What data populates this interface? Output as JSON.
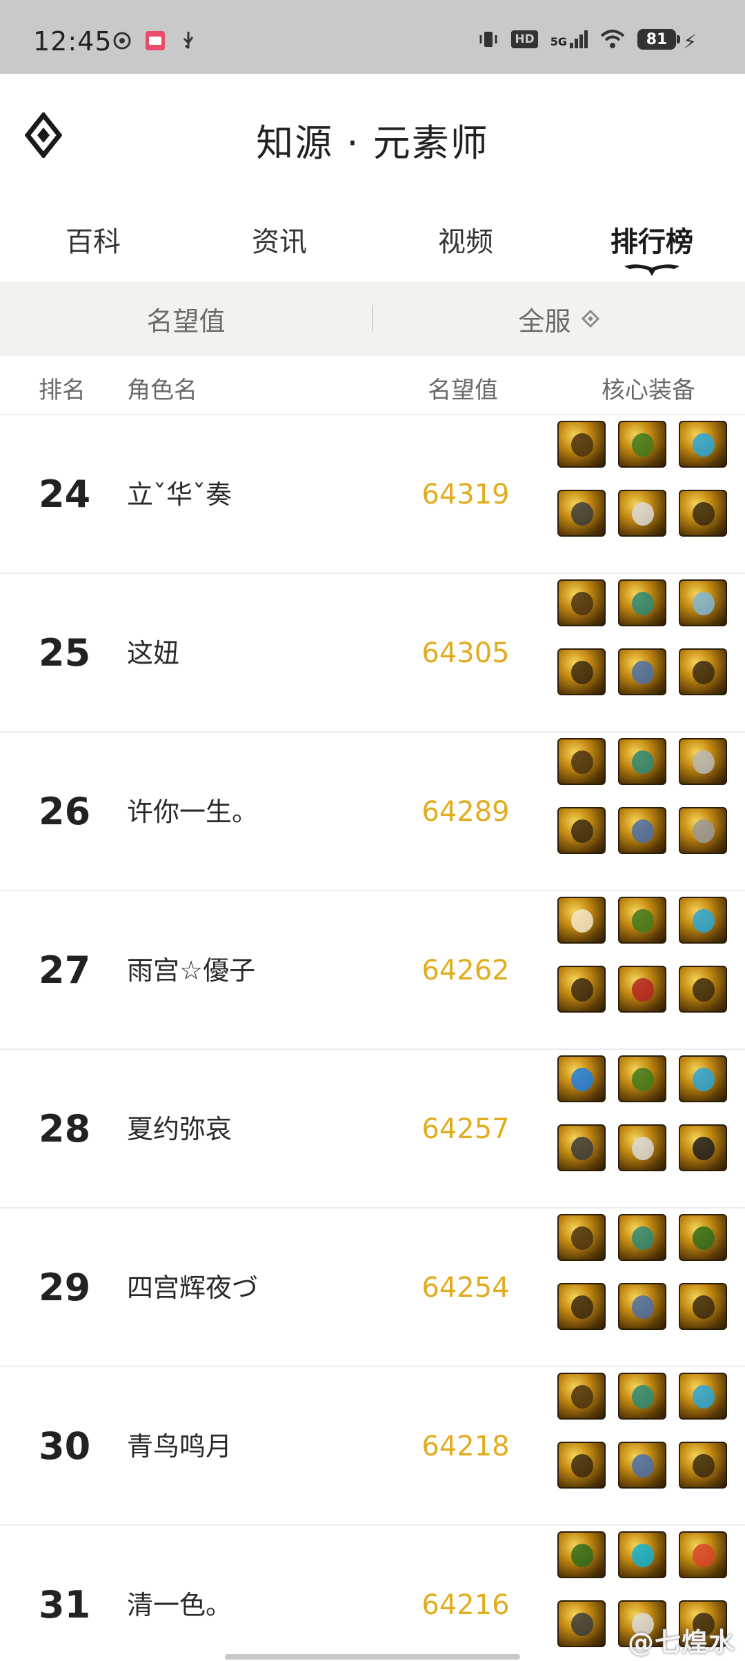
{
  "status_bar": {
    "time": "12:45",
    "hd": "HD",
    "net": "5G",
    "battery": "81"
  },
  "header": {
    "title": "知源 · 元素师"
  },
  "tabs": [
    {
      "label": "百科"
    },
    {
      "label": "资讯"
    },
    {
      "label": "视频"
    },
    {
      "label": "排行榜"
    }
  ],
  "filters": {
    "left": "名望值",
    "right": "全服"
  },
  "columns": {
    "rank": "排名",
    "name": "角色名",
    "score": "名望值",
    "equip": "核心装备"
  },
  "rows": [
    {
      "rank": "24",
      "name": "立ˇ华ˇ奏",
      "score": "64319",
      "icons": [
        "armor",
        "leaf",
        "gem",
        "orb",
        "coat",
        "pants"
      ]
    },
    {
      "rank": "25",
      "name": "这妞",
      "score": "64305",
      "icons": [
        "armor",
        "stone",
        "crystal",
        "pants",
        "sash",
        "pants"
      ]
    },
    {
      "rank": "26",
      "name": "许你一生。",
      "score": "64289",
      "icons": [
        "armor",
        "stone",
        "gauntlet",
        "pants",
        "sash",
        "plate"
      ]
    },
    {
      "rank": "27",
      "name": "雨宫☆優子",
      "score": "64262",
      "icons": [
        "wing",
        "leaf",
        "gem",
        "pants",
        "red-armor",
        "pants"
      ]
    },
    {
      "rank": "28",
      "name": "夏约弥哀",
      "score": "64257",
      "icons": [
        "blue-orb",
        "leaf",
        "gem",
        "orb",
        "coat",
        "dark-pants"
      ]
    },
    {
      "rank": "29",
      "name": "四宫辉夜づ",
      "score": "64254",
      "icons": [
        "armor",
        "stone",
        "green-claw",
        "pants",
        "sash",
        "pants"
      ]
    },
    {
      "rank": "30",
      "name": "青鸟鸣月",
      "score": "64218",
      "icons": [
        "armor",
        "stone",
        "gem",
        "pants",
        "sash",
        "pants"
      ]
    },
    {
      "rank": "31",
      "name": "清一色。",
      "score": "64216",
      "icons": [
        "green-claw",
        "blue-bracelet",
        "red-gem",
        "orb",
        "coat",
        "pants"
      ]
    }
  ],
  "watermark": "@七煌水"
}
